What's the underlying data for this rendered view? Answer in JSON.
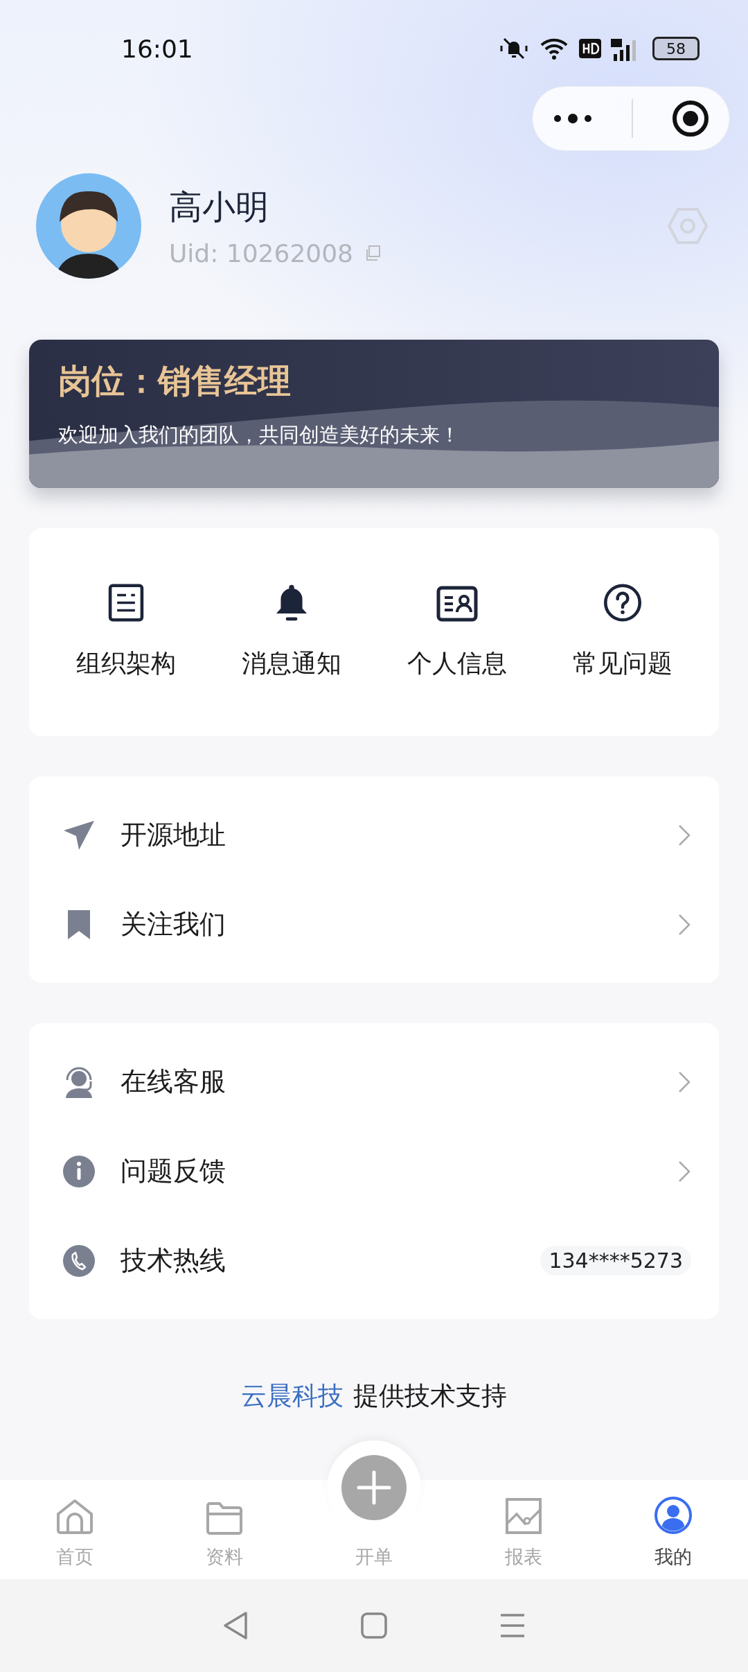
{
  "status_bar": {
    "time": "16:01",
    "battery": "58"
  },
  "profile": {
    "name": "高小明",
    "uid": "Uid: 10262008"
  },
  "banner": {
    "title": "岗位：销售经理",
    "subtitle": "欢迎加入我们的团队，共同创造美好的未来！"
  },
  "shortcuts": [
    "组织架构",
    "消息通知",
    "个人信息",
    "常见问题"
  ],
  "menu_groups": [
    [
      {
        "label": "开源地址",
        "kind": "link"
      },
      {
        "label": "关注我们",
        "kind": "link"
      }
    ],
    [
      {
        "label": "在线客服",
        "kind": "link"
      },
      {
        "label": "问题反馈",
        "kind": "link"
      },
      {
        "label": "技术热线",
        "kind": "value",
        "value": "134****5273"
      }
    ]
  ],
  "footer": {
    "company": "云晨科技",
    "text": "提供技术支持"
  },
  "tabs": [
    {
      "label": "首页",
      "selected": false
    },
    {
      "label": "资料",
      "selected": false
    },
    {
      "label": "开单",
      "selected": false
    },
    {
      "label": "报表",
      "selected": false
    },
    {
      "label": "我的",
      "selected": true
    }
  ]
}
